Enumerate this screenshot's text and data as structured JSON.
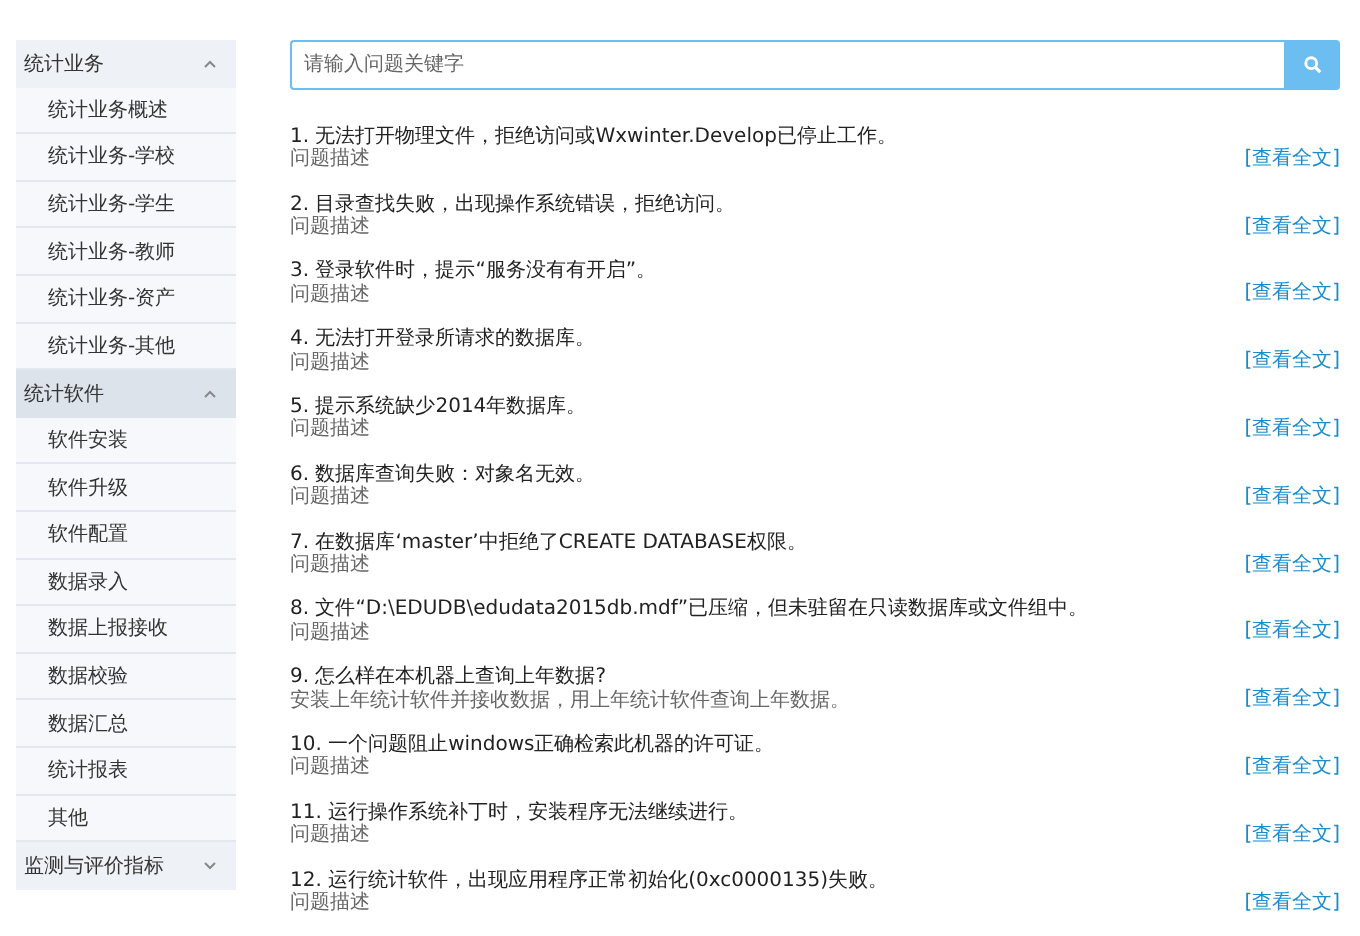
{
  "sidebar": {
    "groups": [
      {
        "label": "统计业务",
        "expanded": true,
        "selected": false,
        "items": [
          "统计业务概述",
          "统计业务-学校",
          "统计业务-学生",
          "统计业务-教师",
          "统计业务-资产",
          "统计业务-其他"
        ]
      },
      {
        "label": "统计软件",
        "expanded": true,
        "selected": true,
        "items": [
          "软件安装",
          "软件升级",
          "软件配置",
          "数据录入",
          "数据上报接收",
          "数据校验",
          "数据汇总",
          "统计报表",
          "其他"
        ]
      },
      {
        "label": "监测与评价指标",
        "expanded": false,
        "selected": false
      }
    ]
  },
  "search": {
    "placeholder": "请输入问题关键字"
  },
  "questions": [
    {
      "title": "1. 无法打开物理文件，拒绝访问或Wxwinter.Develop已停止工作。",
      "description": "问题描述",
      "link": "[查看全文]"
    },
    {
      "title": "2. 目录查找失败，出现操作系统错误，拒绝访问。",
      "description": "问题描述",
      "link": "[查看全文]"
    },
    {
      "title": "3. 登录软件时，提示“服务没有有开启”。",
      "description": "问题描述",
      "link": "[查看全文]"
    },
    {
      "title": "4. 无法打开登录所请求的数据库。",
      "description": "问题描述",
      "link": "[查看全文]"
    },
    {
      "title": "5. 提示系统缺少2014年数据库。",
      "description": "问题描述",
      "link": "[查看全文]"
    },
    {
      "title": "6. 数据库查询失败：对象名无效。",
      "description": "问题描述",
      "link": "[查看全文]"
    },
    {
      "title": "7. 在数据库‘master’中拒绝了CREATE DATABASE权限。",
      "description": "问题描述",
      "link": "[查看全文]"
    },
    {
      "title": "8. 文件“D:\\EDUDB\\edudata2015db.mdf”已压缩，但未驻留在只读数据库或文件组中。",
      "description": "问题描述",
      "link": "[查看全文]"
    },
    {
      "title": "9. 怎么样在本机器上查询上年数据?",
      "description": "安装上年统计软件并接收数据，用上年统计软件查询上年数据。",
      "link": "[查看全文]"
    },
    {
      "title": "10. 一个问题阻止windows正确检索此机器的许可证。",
      "description": "问题描述",
      "link": "[查看全文]"
    },
    {
      "title": "11. 运行操作系统补丁时，安装程序无法继续进行。",
      "description": "问题描述",
      "link": "[查看全文]"
    },
    {
      "title": "12. 运行统计软件，出现应用程序正常初始化(0xc0000135)失败。",
      "description": "问题描述",
      "link": "[查看全文]"
    }
  ]
}
